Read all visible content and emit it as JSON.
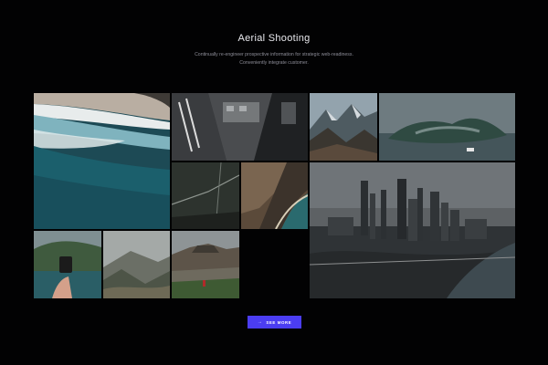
{
  "section": {
    "title": "Aerial Shooting",
    "subtitle_line1": "Continually re-engineer prospective information for strategic web-readiness.",
    "subtitle_line2": "Conveniently integrate customer."
  },
  "gallery": {
    "tiles": [
      {
        "name": "photo-beach-waves",
        "description": "Aerial view of ocean waves on sandy beach"
      },
      {
        "name": "photo-building-rooftop",
        "description": "Aerial view of building rooftop"
      },
      {
        "name": "photo-mountain-peaks",
        "description": "Rocky mountain peaks"
      },
      {
        "name": "photo-misty-island",
        "description": "Misty island with boat"
      },
      {
        "name": "photo-dark-field-roads",
        "description": "Dark field with crossing paths"
      },
      {
        "name": "photo-coastal-cliffs",
        "description": "Coastal cliffs and shoreline"
      },
      {
        "name": "photo-city-skyline",
        "description": "Aerial city skyline with skyscrapers"
      },
      {
        "name": "photo-hand-holding-phone",
        "description": "Hand holding phone over lake"
      },
      {
        "name": "photo-foggy-mountains",
        "description": "Foggy mountain slopes"
      },
      {
        "name": "photo-volcano-hiker",
        "description": "Volcano with hiker in foreground"
      }
    ]
  },
  "button": {
    "label": "SEE MORE",
    "arrow": "→"
  },
  "colors": {
    "background": "#020203",
    "button": "#4b3df2"
  }
}
